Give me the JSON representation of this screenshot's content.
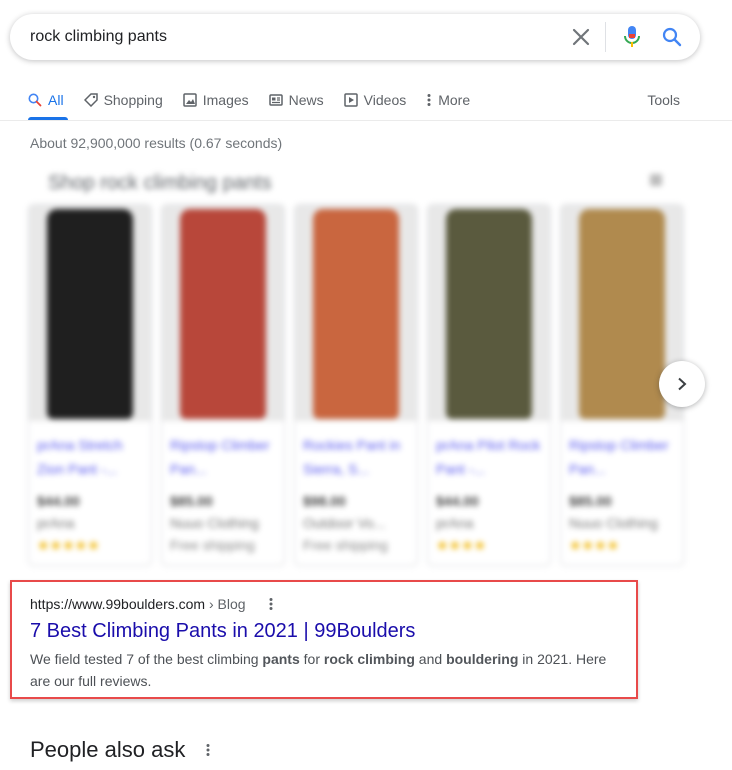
{
  "search": {
    "query": "rock climbing pants"
  },
  "tabs": {
    "items": [
      {
        "label": "All",
        "icon": "search-icon",
        "active": true
      },
      {
        "label": "Shopping",
        "icon": "tag-icon"
      },
      {
        "label": "Images",
        "icon": "image-icon"
      },
      {
        "label": "News",
        "icon": "news-icon"
      },
      {
        "label": "Videos",
        "icon": "video-icon"
      },
      {
        "label": "More",
        "icon": "more-vert-icon"
      }
    ],
    "tools_label": "Tools"
  },
  "stats": "About 92,900,000 results (0.67 seconds)",
  "shopping": {
    "title": "Shop rock climbing pants",
    "cards": [
      {
        "title": "prAna Stretch Zion Pant -...",
        "price": "$44.00",
        "store": "prAna",
        "stars": "★★★★★",
        "pant_color": "#1f1f1f"
      },
      {
        "title": "Ripstop Climber Pan...",
        "price": "$85.00",
        "store": "Nuuo Clothing",
        "stars": "Free shipping",
        "pant_color": "#b8473a"
      },
      {
        "title": "Rockies Pant in Sierra, S...",
        "price": "$98.00",
        "store": "Outdoor Vo...",
        "stars": "Free shipping",
        "pant_color": "#c9663f"
      },
      {
        "title": "prAna Pilot Rock Pant -...",
        "price": "$44.00",
        "store": "prAna",
        "stars": "★★★★",
        "pant_color": "#5a5a3e"
      },
      {
        "title": "Ripstop Climber Pan...",
        "price": "$85.00",
        "store": "Nuuo Clothing",
        "stars": "★★★★",
        "pant_color": "#b08a4e"
      }
    ]
  },
  "result": {
    "url": "https://www.99boulders.com",
    "crumb": "› Blog",
    "title": "7 Best Climbing Pants in 2021 | 99Boulders",
    "snippet_1": "We field tested 7 of the best climbing ",
    "snippet_b1": "pants",
    "snippet_2": " for ",
    "snippet_b2": "rock climbing",
    "snippet_3": " and ",
    "snippet_b3": "bouldering",
    "snippet_4": " in 2021. Here are our full reviews."
  },
  "people_also_ask": "People also ask",
  "colors": {
    "accent": "#1a73e8",
    "link": "#1a0dab",
    "highlight_border": "#e84a4a"
  }
}
